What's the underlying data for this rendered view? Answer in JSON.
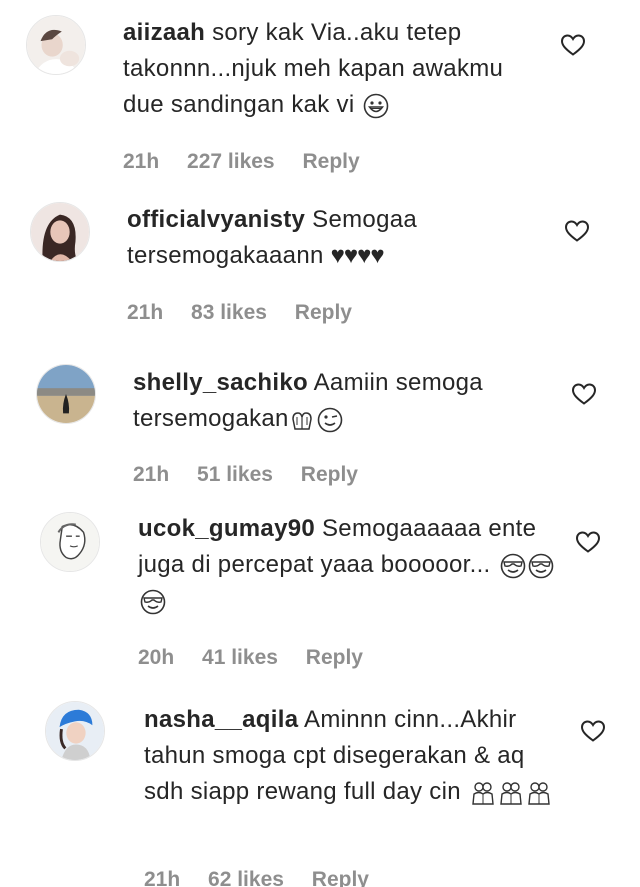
{
  "comments": [
    {
      "username": "aiizaah",
      "text": "sory kak Via..aku tetep takonnn...njuk meh kapan awakmu due sandingan kak vi",
      "emoji": "grinning-face-icon",
      "time": "21h",
      "likes": "227 likes",
      "reply": "Reply"
    },
    {
      "username": "officialvyanisty",
      "text": "Semogaa tersemogakaaann",
      "emoji_text": "♥♥♥♥",
      "time": "21h",
      "likes": "83 likes",
      "reply": "Reply"
    },
    {
      "username": "shelly_sachiko",
      "text": "Aamiin semoga tersemogakan",
      "emoji": "praying-hands-and-winking-face-icons",
      "time": "21h",
      "likes": "51 likes",
      "reply": "Reply"
    },
    {
      "username": "ucok_gumay90",
      "text": "Semogaaaaaa ente juga di percepat yaaa booooor...",
      "emoji": "smiling-face-with-sunglasses-icon x3",
      "time": "20h",
      "likes": "41 likes",
      "reply": "Reply"
    },
    {
      "username": "nasha__aqila",
      "text": "Aminnn cinn...Akhir tahun smoga cpt disegerakan & aq sdh siapp rewang full day cin",
      "emoji": "people-hugging-icon x3",
      "time": "21h",
      "likes": "62 likes",
      "reply": "Reply"
    }
  ],
  "colors": {
    "username": "#262626",
    "meta": "#8e8e8e",
    "heart_stroke": "#262626"
  }
}
